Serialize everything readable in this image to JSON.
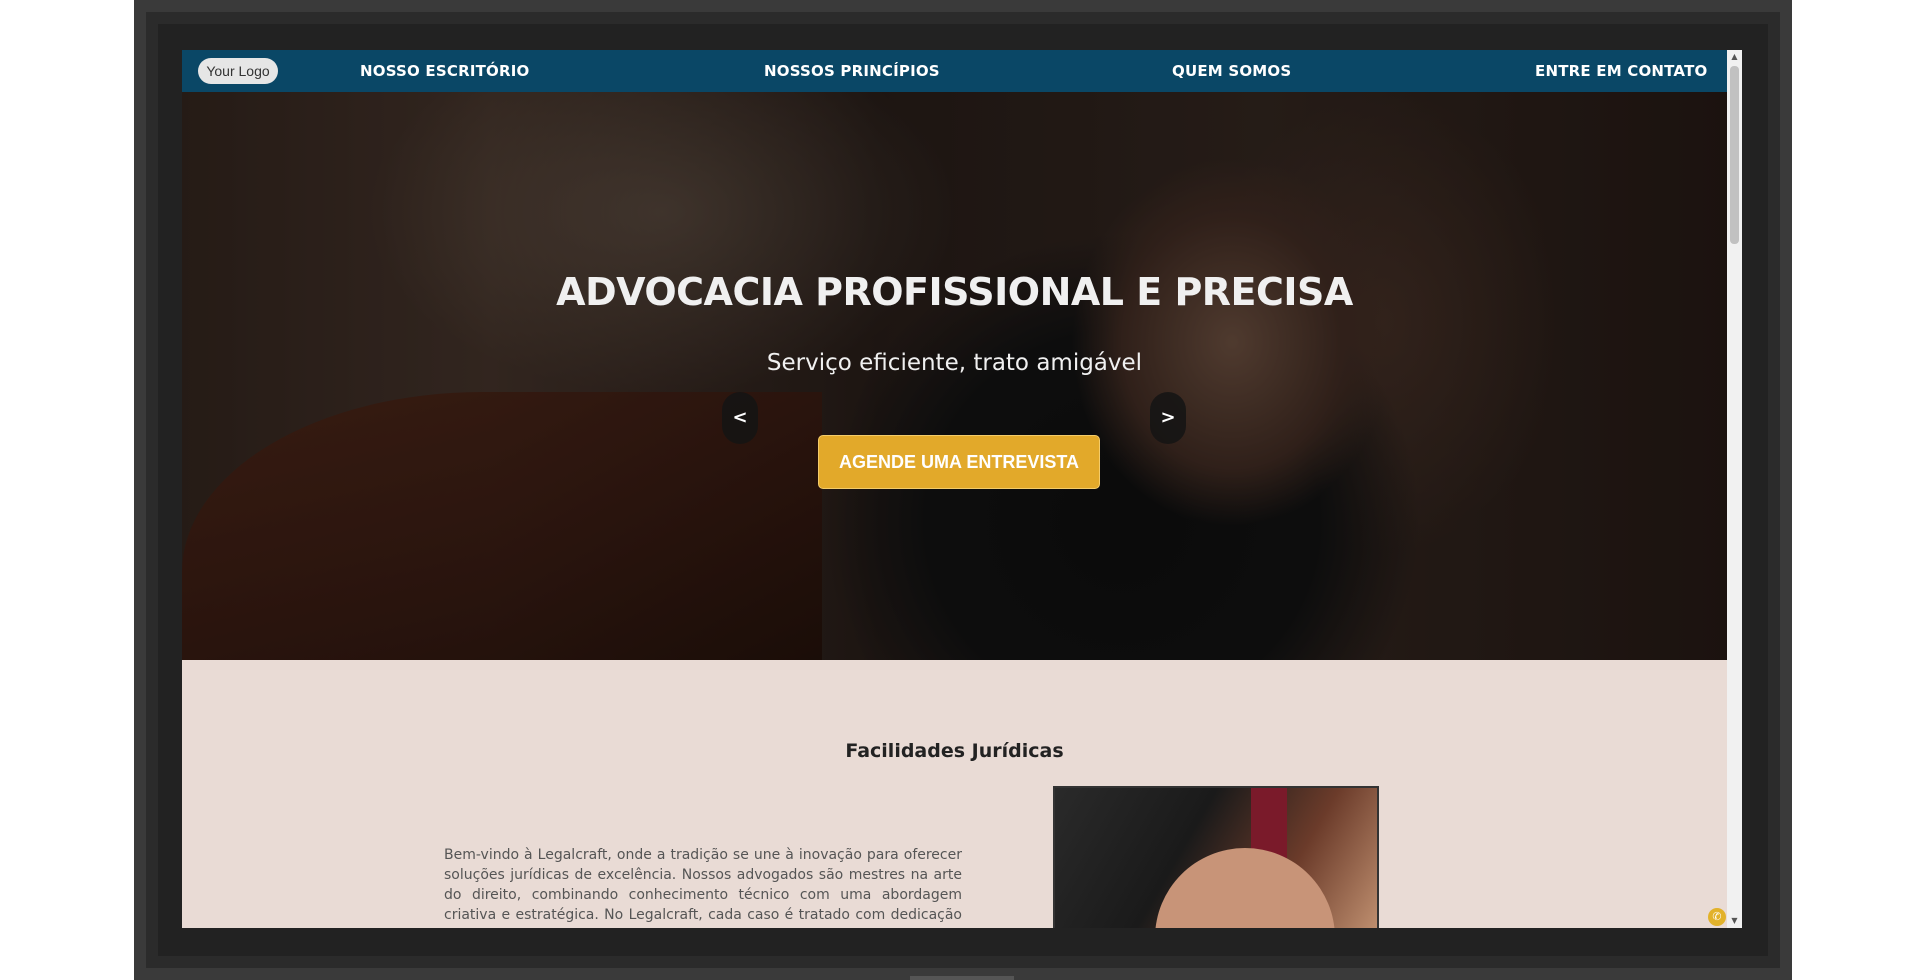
{
  "navbar": {
    "logo_text": "Your Logo",
    "links": [
      {
        "label": "NOSSO ESCRITÓRIO"
      },
      {
        "label": "NOSSOS PRINCÍPIOS"
      },
      {
        "label": "QUEM SOMOS"
      },
      {
        "label": "ENTRE EM CONTATO"
      }
    ]
  },
  "hero": {
    "title": "ADVOCACIA PROFISSIONAL E PRECISA",
    "subtitle": "Serviço eficiente, trato amigável",
    "prev_label": "<",
    "next_label": ">",
    "cta_label": "AGENDE UMA ENTREVISTA"
  },
  "section": {
    "title": "Facilidades Jurídicas",
    "intro": "Bem-vindo à Legalcraft, onde a tradição se une à inovação para oferecer soluções jurídicas de excelência. Nossos advogados são mestres na arte do direito, combinando conhecimento técnico com uma abordagem criativa e estratégica. No Legalcraft, cada caso é tratado com dedicação e expertise,"
  },
  "widgets": {
    "whatsapp_icon": "whatsapp-icon",
    "scroll_up_glyph": "▲",
    "scroll_down_glyph": "▼"
  },
  "colors": {
    "navbar": "#0a4766",
    "cta": "#e2a92a",
    "section_bg": "#e9dbd5"
  }
}
